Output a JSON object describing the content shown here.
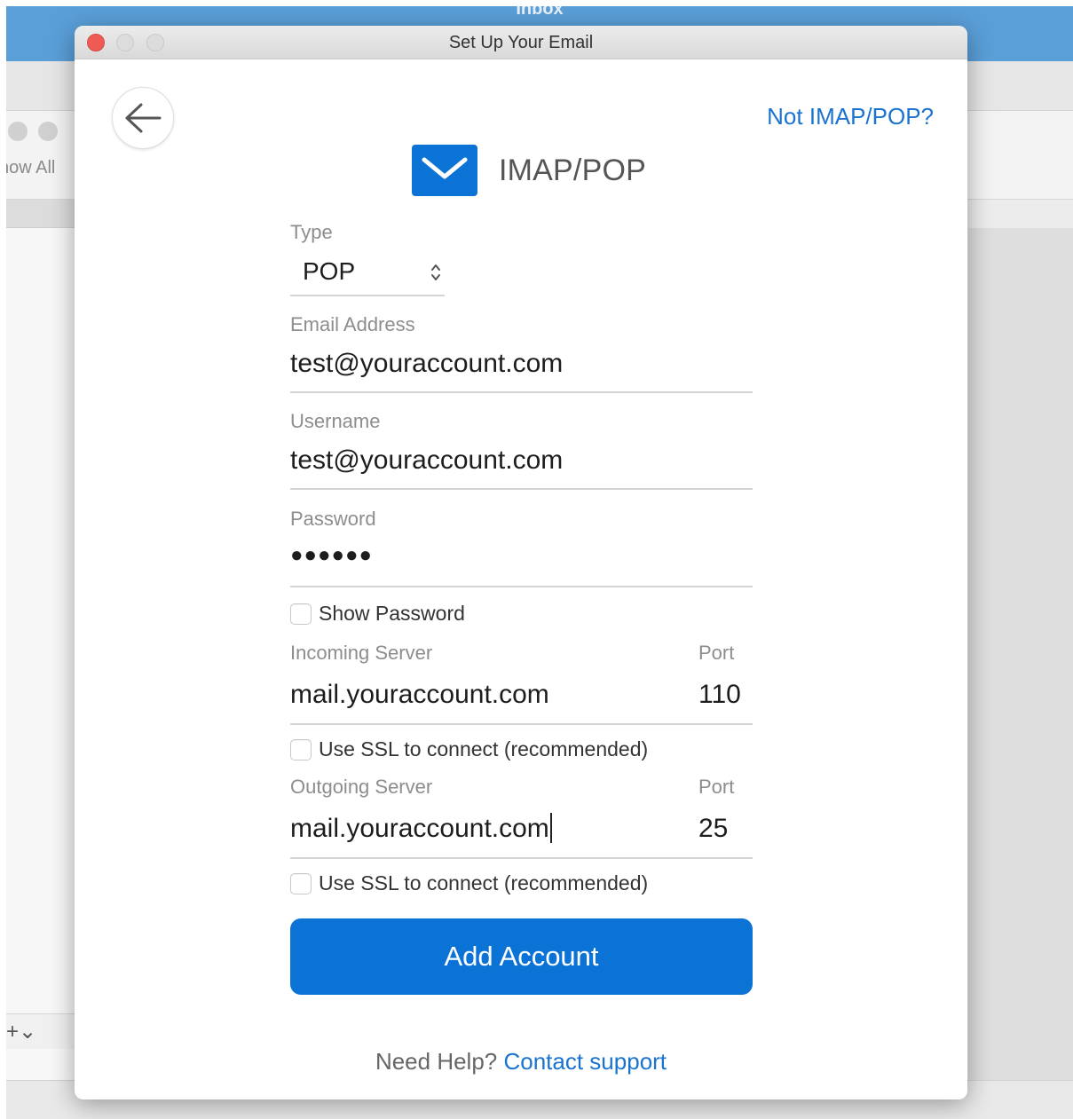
{
  "background_app": {
    "title": "Inbox",
    "toolbar_text": "how All",
    "bottom_controls": "+⌄"
  },
  "dialog": {
    "title": "Set Up Your Email",
    "not_imap_link": "Not IMAP/POP?",
    "header_title": "IMAP/POP",
    "type": {
      "label": "Type",
      "value": "POP"
    },
    "email": {
      "label": "Email Address",
      "value": "test@youraccount.com"
    },
    "username": {
      "label": "Username",
      "value": "test@youraccount.com"
    },
    "password": {
      "label": "Password",
      "value": "●●●●●●"
    },
    "show_password": "Show Password",
    "incoming": {
      "label": "Incoming Server",
      "value": "mail.youraccount.com",
      "port_label": "Port",
      "port_value": "110",
      "ssl_label": "Use SSL to connect (recommended)"
    },
    "outgoing": {
      "label": "Outgoing Server",
      "value": "mail.youraccount.com",
      "port_label": "Port",
      "port_value": "25",
      "ssl_label": "Use SSL to connect (recommended)"
    },
    "add_account_label": "Add Account",
    "help_text": "Need Help?",
    "help_link": "Contact support"
  },
  "colors": {
    "accent": "#0b72d6",
    "link": "#1a73d1",
    "titlebar_bg_app": "#5a9fd8",
    "close_button": "#ee5b52"
  },
  "icons": {
    "back": "arrow-left-icon",
    "header": "envelope-icon",
    "select": "chevron-up-down-icon"
  }
}
